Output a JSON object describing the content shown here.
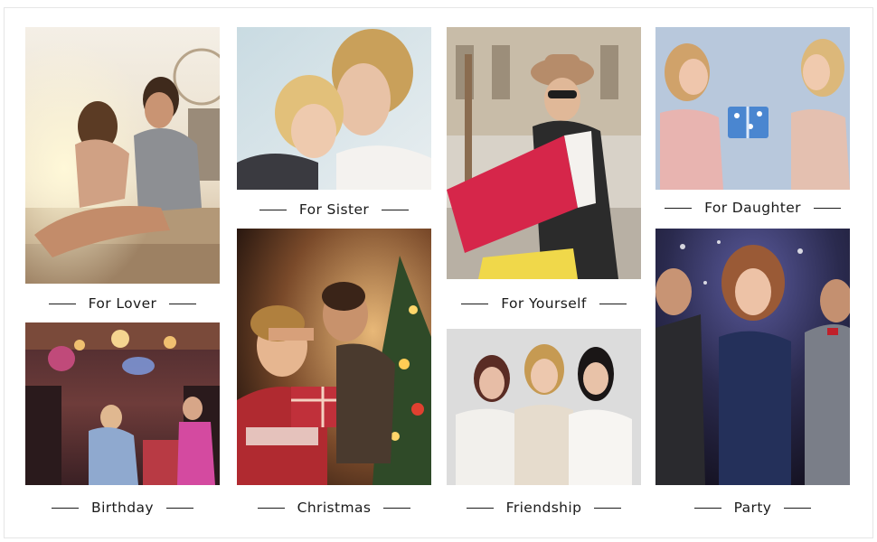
{
  "tiles": {
    "lover": {
      "caption": "For Lover"
    },
    "birthday": {
      "caption": "Birthday"
    },
    "sister": {
      "caption": "For Sister"
    },
    "christmas": {
      "caption": "Christmas"
    },
    "yourself": {
      "caption": "For Yourself"
    },
    "friendship": {
      "caption": "Friendship"
    },
    "daughter": {
      "caption": "For Daughter"
    },
    "party": {
      "caption": "Party"
    }
  },
  "colors": {
    "caption_text": "#1a1a1a",
    "background": "#ffffff"
  }
}
